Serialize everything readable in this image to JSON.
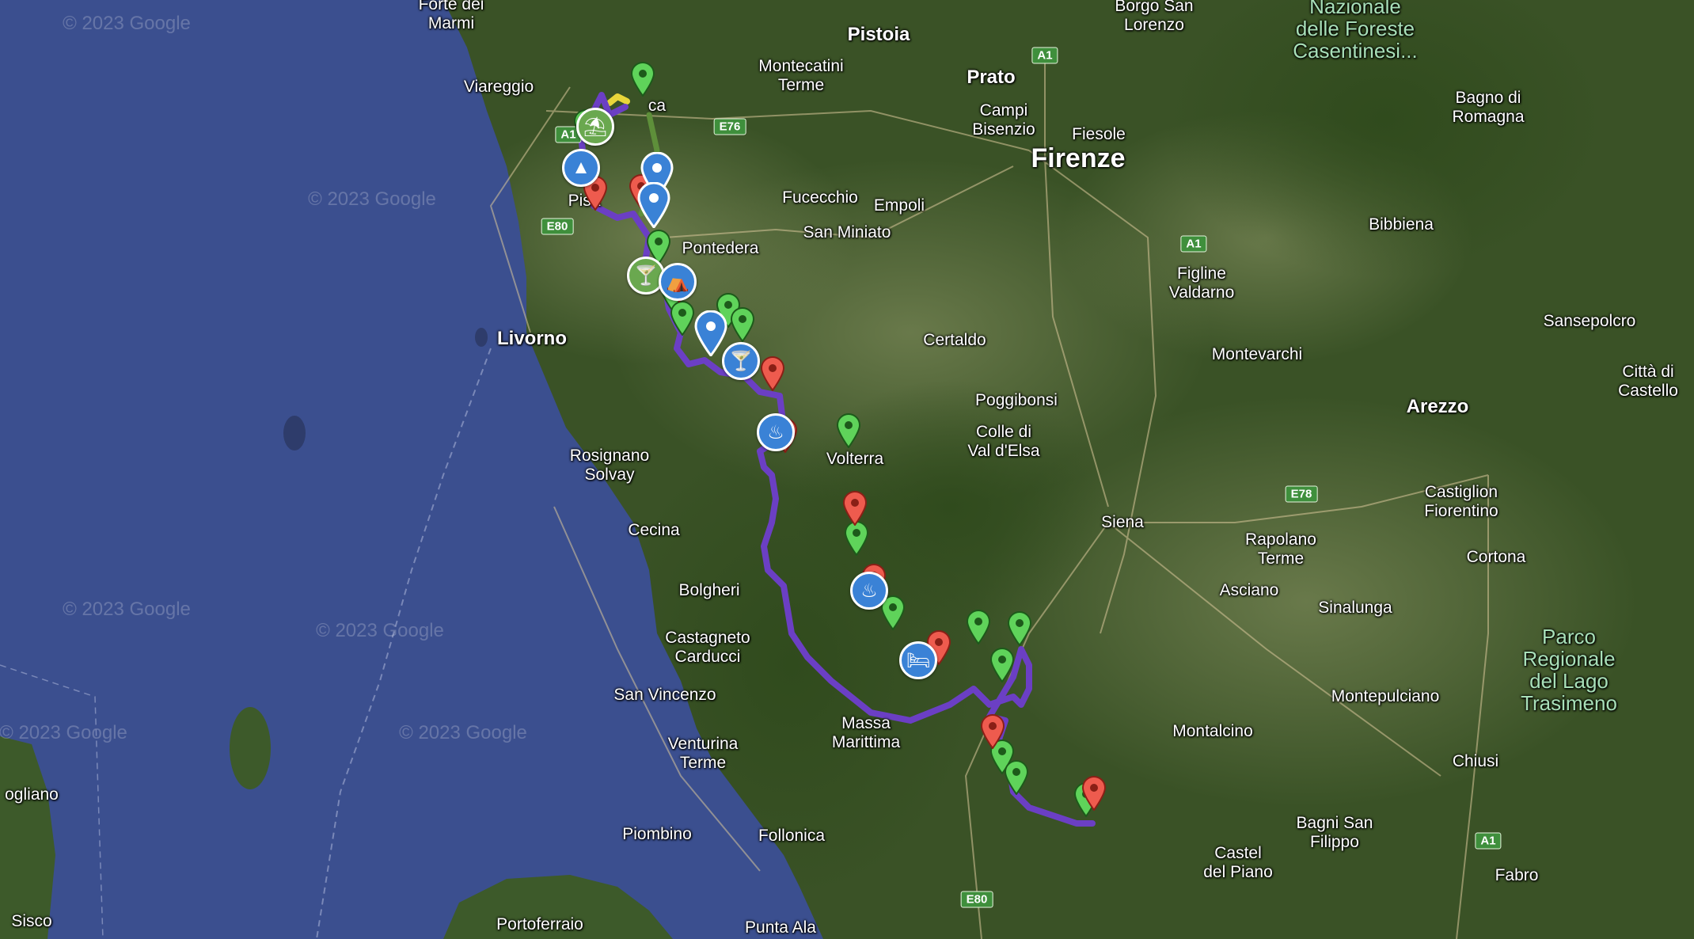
{
  "map": {
    "watermark": "© 2023 Google",
    "colors": {
      "sea": "#3b4f8f",
      "land": "#3a5226",
      "route_main": "#6b3fc4",
      "route_alt": "#5e8f3a",
      "route_start": "#e8d63a",
      "pin_green": "#5fd35a",
      "pin_red": "#ee5b4e",
      "poi_blue": "#3a82d6",
      "poi_green": "#6aa84f"
    },
    "labels": [
      {
        "id": "forte-dei-marmi",
        "text": "Forte dei\nMarmi"
      },
      {
        "id": "viareggio",
        "text": "Viareggio"
      },
      {
        "id": "lucca",
        "text": "ca"
      },
      {
        "id": "pisa",
        "text": "Pisa"
      },
      {
        "id": "montecatini",
        "text": "Montecatini\nTerme"
      },
      {
        "id": "pistoia",
        "text": "Pistoia"
      },
      {
        "id": "prato",
        "text": "Prato"
      },
      {
        "id": "campi-bisenzio",
        "text": "Campi\nBisenzio"
      },
      {
        "id": "fiesole",
        "text": "Fiesole"
      },
      {
        "id": "firenze",
        "text": "Firenze"
      },
      {
        "id": "borgo-san-lorenzo",
        "text": "Borgo San\nLorenzo"
      },
      {
        "id": "foreste-casentinesi",
        "text": "Nazionale\ndelle Foreste\nCasentinesi..."
      },
      {
        "id": "bagno-di-romagna",
        "text": "Bagno di\nRomagna"
      },
      {
        "id": "fucecchio",
        "text": "Fucecchio"
      },
      {
        "id": "empoli",
        "text": "Empoli"
      },
      {
        "id": "san-miniato",
        "text": "San Miniato"
      },
      {
        "id": "pontedera",
        "text": "Pontedera"
      },
      {
        "id": "bibbiena",
        "text": "Bibbiena"
      },
      {
        "id": "figline",
        "text": "Figline\nValdarno"
      },
      {
        "id": "sansepolcro",
        "text": "Sansepolcro"
      },
      {
        "id": "livorno",
        "text": "Livorno"
      },
      {
        "id": "certaldo",
        "text": "Certaldo"
      },
      {
        "id": "montevarchi",
        "text": "Montevarchi"
      },
      {
        "id": "poggibonsi",
        "text": "Poggibonsi"
      },
      {
        "id": "citta-di-castello",
        "text": "Città di\nCastello"
      },
      {
        "id": "arezzo",
        "text": "Arezzo"
      },
      {
        "id": "colle-val-delsa",
        "text": "Colle di\nVal d'Elsa"
      },
      {
        "id": "rosignano",
        "text": "Rosignano\nSolvay"
      },
      {
        "id": "volterra",
        "text": "Volterra"
      },
      {
        "id": "siena",
        "text": "Siena"
      },
      {
        "id": "rapolano",
        "text": "Rapolano\nTerme"
      },
      {
        "id": "castiglion-fiorentino",
        "text": "Castiglion\nFiorentino"
      },
      {
        "id": "cecina",
        "text": "Cecina"
      },
      {
        "id": "cortona",
        "text": "Cortona"
      },
      {
        "id": "bolgheri",
        "text": "Bolgheri"
      },
      {
        "id": "asciano",
        "text": "Asciano"
      },
      {
        "id": "sinalunga",
        "text": "Sinalunga"
      },
      {
        "id": "castagneto",
        "text": "Castagneto\nCarducci"
      },
      {
        "id": "trasimeno",
        "text": "Parco\nRegionale\ndel Lago\nTrasimeno"
      },
      {
        "id": "san-vincenzo",
        "text": "San Vincenzo"
      },
      {
        "id": "montepulciano",
        "text": "Montepulciano"
      },
      {
        "id": "massa-marittima",
        "text": "Massa\nMarittima"
      },
      {
        "id": "montalcino",
        "text": "Montalcino"
      },
      {
        "id": "venturina",
        "text": "Venturina\nTerme"
      },
      {
        "id": "chiusi",
        "text": "Chiusi"
      },
      {
        "id": "gliano",
        "text": "ogliano"
      },
      {
        "id": "bagni-san-filippo",
        "text": "Bagni San\nFilippo"
      },
      {
        "id": "piombino",
        "text": "Piombino"
      },
      {
        "id": "follonica",
        "text": "Follonica"
      },
      {
        "id": "castel-del-piano",
        "text": "Castel\ndel Piano"
      },
      {
        "id": "fabro",
        "text": "Fabro"
      },
      {
        "id": "sisco",
        "text": "Sisco"
      },
      {
        "id": "portoferraio",
        "text": "Portoferraio"
      },
      {
        "id": "punta-ala",
        "text": "Punta Ala"
      }
    ],
    "highways": [
      "A1",
      "A1",
      "A1",
      "A1",
      "A1",
      "E76",
      "E80",
      "E78",
      "E80"
    ]
  }
}
